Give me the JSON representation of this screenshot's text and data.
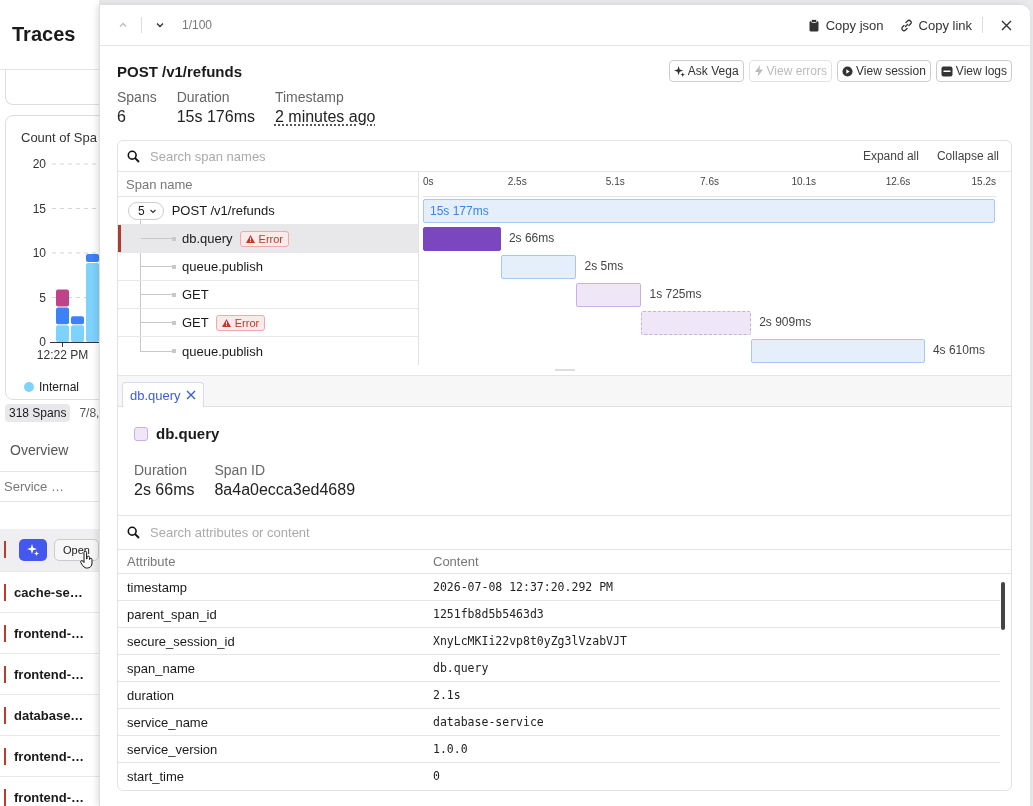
{
  "background": {
    "title": "Traces",
    "chart": {
      "title": "Count of Spa",
      "chart_data": {
        "type": "bar",
        "stacked": true,
        "grid": true,
        "categories": [
          "12:22 PM",
          null,
          null
        ],
        "yticks": [
          0,
          5,
          10,
          15,
          20
        ],
        "ylim": [
          0,
          20
        ],
        "series": [
          {
            "name": "Internal",
            "color": "#7dd3fc",
            "values": [
              2,
              2,
              9
            ]
          },
          {
            "color": "#3b82f6",
            "values": [
              2,
              1,
              1
            ]
          },
          {
            "color": "#c0438a",
            "values": [
              2,
              0,
              0
            ]
          }
        ]
      }
    },
    "span_count": "318 Spans",
    "date": "7/8,",
    "tabs": [
      {
        "label": "Overview",
        "selected": false
      }
    ],
    "column": "Service …",
    "rows": [
      {
        "kind": "actions",
        "open": "Open",
        "error": true
      },
      {
        "kind": "service",
        "name": "cache-se…",
        "error": true
      },
      {
        "kind": "service",
        "name": "frontend-…",
        "error": true
      },
      {
        "kind": "service",
        "name": "frontend-…",
        "error": true
      },
      {
        "kind": "service",
        "name": "database…",
        "error": true
      },
      {
        "kind": "service",
        "name": "frontend-…",
        "error": true
      },
      {
        "kind": "service",
        "name": "frontend-…",
        "error": true
      }
    ]
  },
  "drawer": {
    "position": "1/100",
    "prev_disabled": true,
    "actions": [
      {
        "kind": "copy",
        "label": "Copy json"
      },
      {
        "kind": "link",
        "label": "Copy link"
      }
    ],
    "title": "POST /v1/refunds",
    "buttons": [
      {
        "kind": "ask",
        "label": "Ask Vega",
        "disabled": false
      },
      {
        "kind": "errors",
        "label": "View errors",
        "disabled": true
      },
      {
        "kind": "session",
        "label": "View session",
        "disabled": false
      },
      {
        "kind": "logs",
        "label": "View logs",
        "disabled": false
      }
    ],
    "stats": [
      {
        "label": "Spans",
        "value": "6"
      },
      {
        "label": "Duration",
        "value": "15s 176ms"
      },
      {
        "label": "Timestamp",
        "value": "2 minutes ago"
      }
    ],
    "timeline": {
      "search_placeholder": "Search span names",
      "expand": "Expand all",
      "collapse": "Collapse all",
      "column": "Span name",
      "ticks": [
        "0s",
        "2.5s",
        "5.1s",
        "7.6s",
        "10.1s",
        "12.6s",
        "15.2s"
      ],
      "root": {
        "name": "POST /v1/refunds",
        "duration": "15s 177ms",
        "child_count": "5",
        "selected": false,
        "color": "#a8c7f3",
        "children": [
          {
            "name": "db.query",
            "duration": "2s 66ms",
            "selected": true,
            "badge": "Error",
            "color": "#7a47bf"
          },
          {
            "name": "queue.publish",
            "duration": "2s 5ms",
            "selected": false,
            "color": "#a8c7f3"
          },
          {
            "name": "GET",
            "duration": "1s 725ms",
            "selected": false,
            "color": "#c9b0e3"
          },
          {
            "name": "GET",
            "duration": "2s 909ms",
            "selected": false,
            "badge": "Error",
            "color": "#c9b0e3"
          },
          {
            "name": "queue.publish",
            "duration": "4s 610ms",
            "selected": false,
            "color": "#a8c7f3"
          }
        ]
      }
    },
    "detail_tabs": [
      {
        "label": "db.query",
        "selected": true
      }
    ],
    "detail": {
      "title": "db.query",
      "color": "#c9b0e3",
      "fields": [
        {
          "label": "Duration",
          "value": "2s 66ms"
        },
        {
          "label": "Span ID",
          "value": "8a4a0ecca3ed4689"
        }
      ]
    },
    "attributes": {
      "placeholder": "Search attributes or content",
      "columns": [
        "Attribute",
        "Content"
      ],
      "rows": [
        {
          "name": "timestamp",
          "value": "2026-07-08 12:37:20.292 PM"
        },
        {
          "name": "parent_span_id",
          "value": "1251fb8d5b5463d3"
        },
        {
          "name": "secure_session_id",
          "value": "XnyLcMKIi22vp8t0yZg3lVzabVJT"
        },
        {
          "name": "span_name",
          "value": "db.query"
        },
        {
          "name": "duration",
          "value": "2.1s"
        },
        {
          "name": "service_name",
          "value": "database-service"
        },
        {
          "name": "service_version",
          "value": "1.0.0"
        },
        {
          "name": "start_time",
          "value": "0"
        }
      ]
    }
  }
}
